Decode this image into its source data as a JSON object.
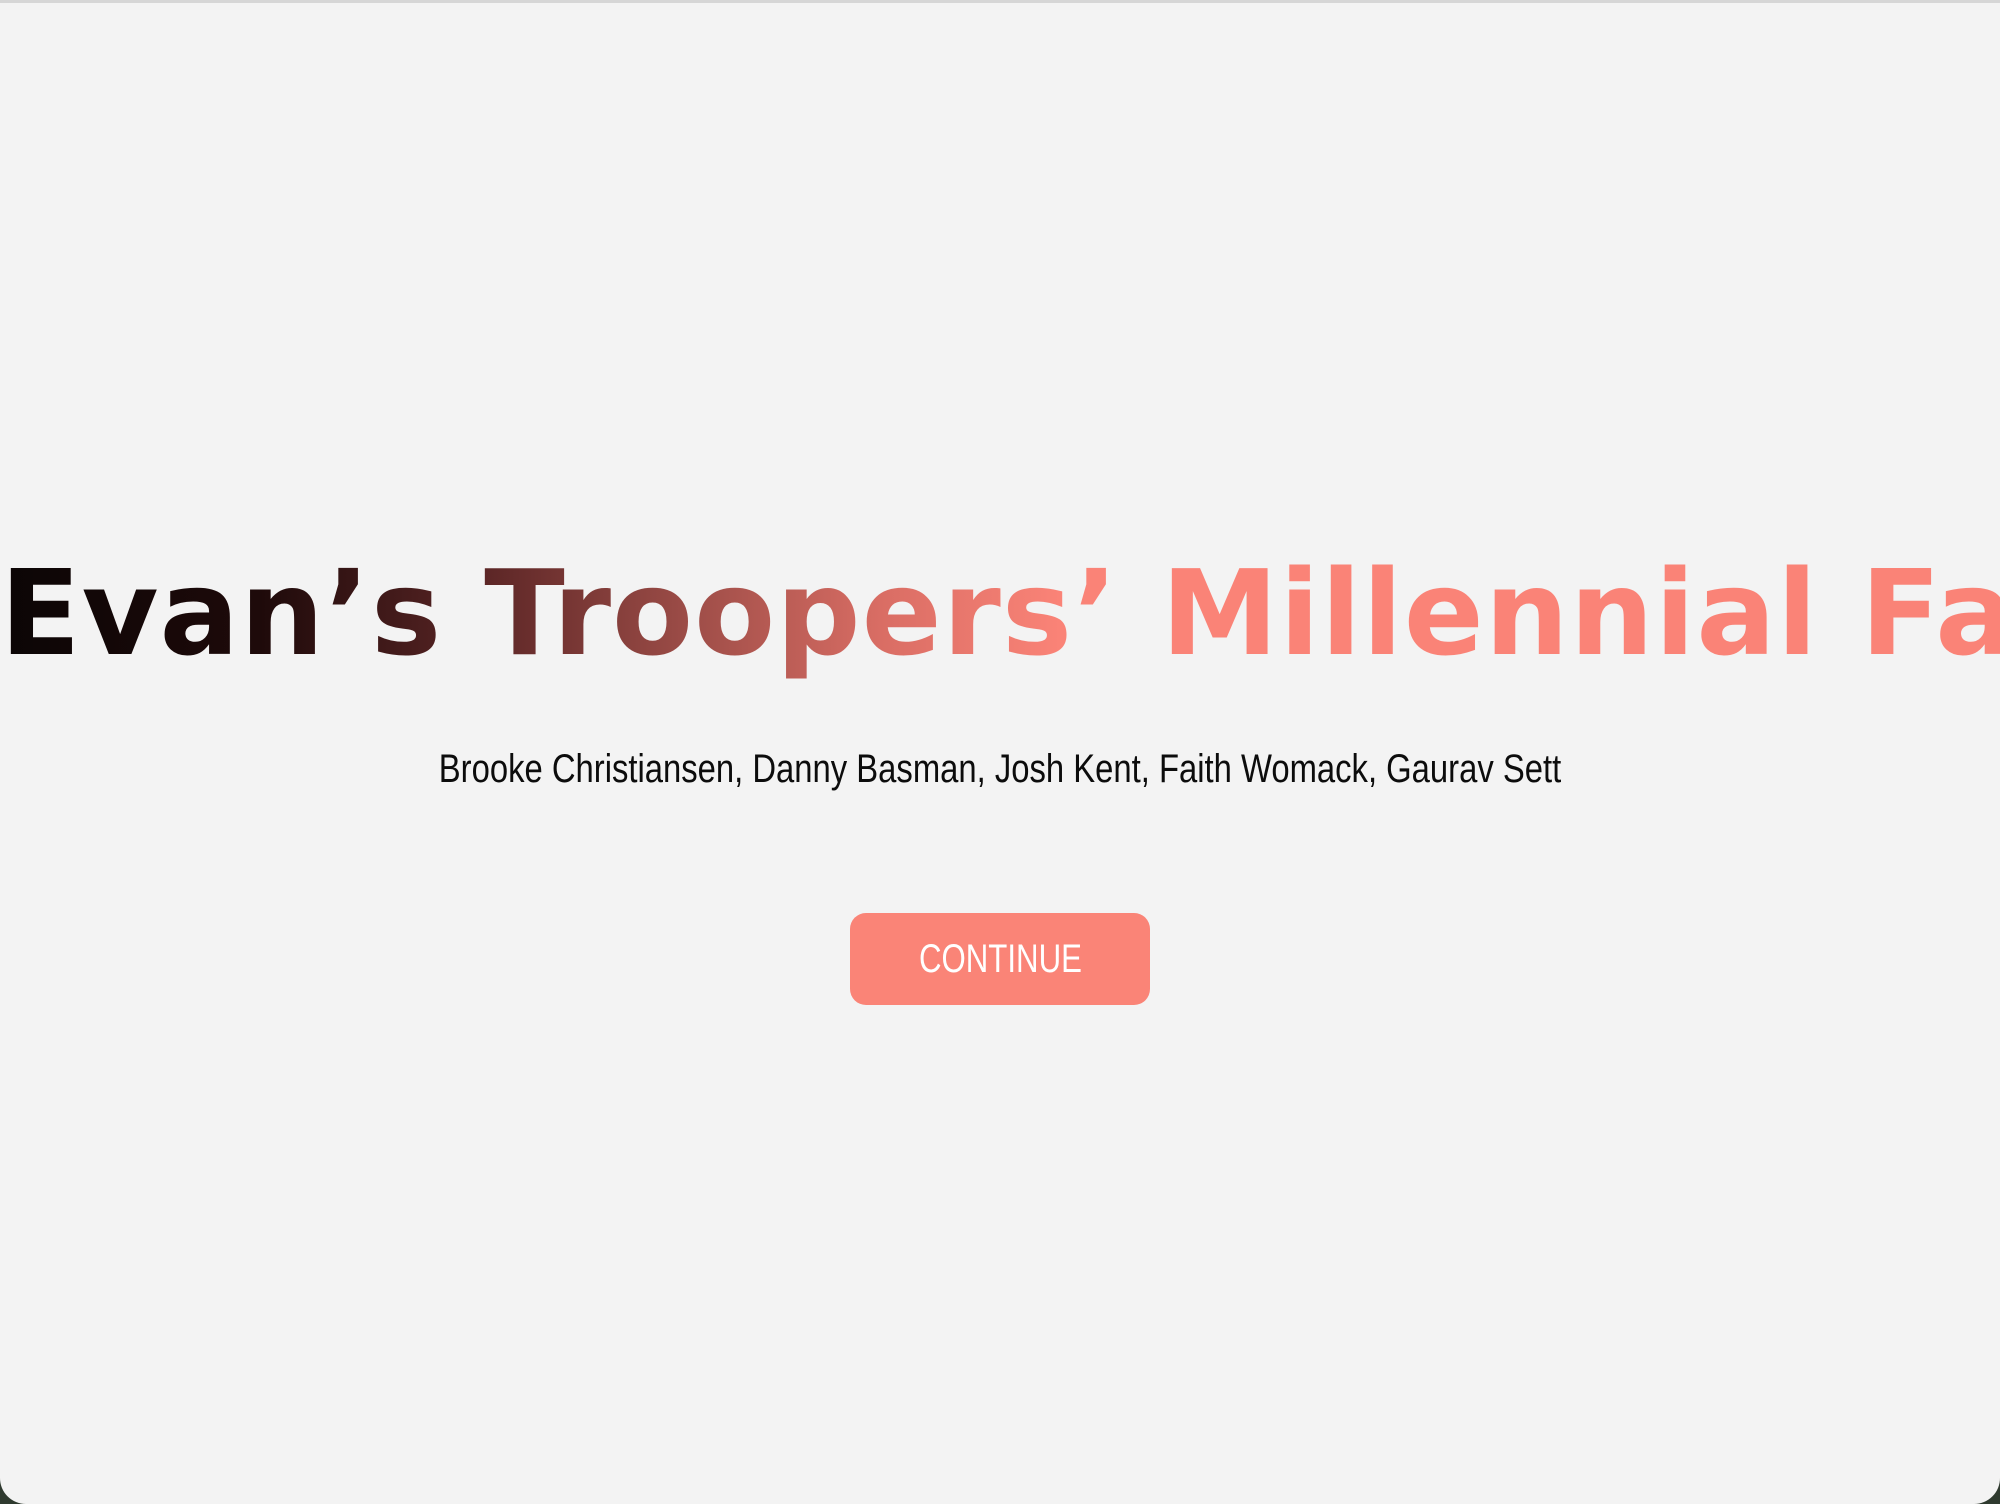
{
  "page": {
    "title": "Evan’s Troopers’ Millennial Farm",
    "authors": "Brooke Christiansen, Danny Basman, Josh Kent, Faith Womack, Gaurav Sett",
    "continue_label": "CONTINUE"
  },
  "colors": {
    "background": "#f3f3f3",
    "accent": "#fa8477",
    "title_gradient_start": "#0b0505",
    "title_gradient_end": "#fa8377"
  }
}
